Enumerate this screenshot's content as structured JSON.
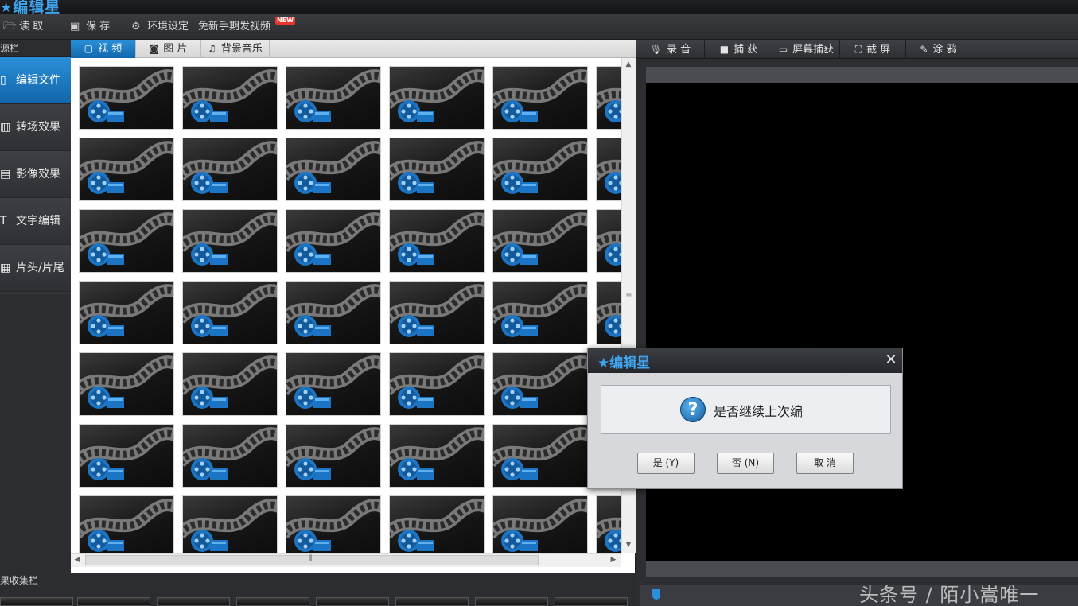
{
  "app": {
    "title": "编辑星"
  },
  "menu": {
    "items": [
      {
        "label": "读 取",
        "icon": "folder-open-icon"
      },
      {
        "label": "保 存",
        "icon": "floppy-disk-icon"
      },
      {
        "label": "环境设定",
        "icon": "gear-icon"
      },
      {
        "label": "免新手期发视频",
        "icon": ""
      }
    ],
    "new_badge": "NEW"
  },
  "sidebar": {
    "header": "源栏",
    "items": [
      {
        "label": "编辑文件",
        "icon": "film-strip-icon",
        "active": true
      },
      {
        "label": "转场效果",
        "icon": "transition-icon",
        "active": false
      },
      {
        "label": "影像效果",
        "icon": "image-effect-icon",
        "active": false
      },
      {
        "label": "文字编辑",
        "icon": "text-edit-icon",
        "active": false
      },
      {
        "label": "片头/片尾",
        "icon": "intro-outro-icon",
        "active": false
      }
    ]
  },
  "library": {
    "tabs": [
      {
        "label": "视 频",
        "icon": "video-square-icon",
        "active": true
      },
      {
        "label": "图 片",
        "icon": "camera-icon",
        "active": false
      },
      {
        "label": "背景音乐",
        "icon": "music-note-icon",
        "active": false
      }
    ]
  },
  "results": {
    "header": "果收集栏"
  },
  "capture": {
    "tabs": [
      {
        "label": "录 音",
        "icon": "microphone-icon"
      },
      {
        "label": "捕 获",
        "icon": "video-camera-icon"
      },
      {
        "label": "屏幕捕获",
        "icon": "monitor-icon"
      },
      {
        "label": "截 屏",
        "icon": "screenshot-icon"
      },
      {
        "label": "涂 鸦",
        "icon": "brush-icon"
      }
    ]
  },
  "watermark": "头条号 / 陌小嵩唯一",
  "dialog": {
    "title": "编辑星",
    "message": "是否继续上次编",
    "buttons": [
      {
        "label": "是 (Y)"
      },
      {
        "label": "否 (N)"
      },
      {
        "label": "取 消"
      }
    ]
  },
  "colors": {
    "accent": "#2a8fd8",
    "logo": "#3fa5f0",
    "badge": "#e8352e"
  }
}
